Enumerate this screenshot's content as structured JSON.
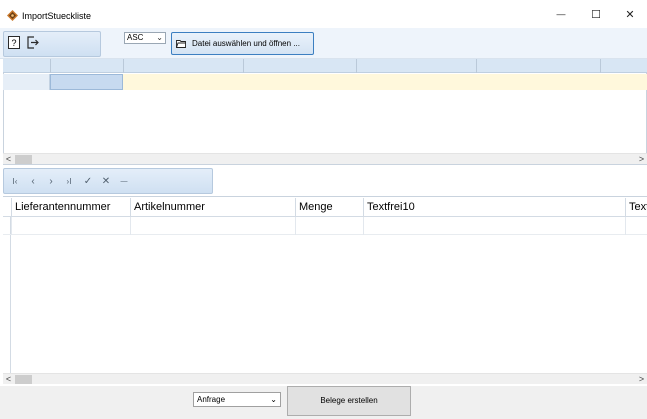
{
  "window": {
    "title": "ImportStueckliste",
    "minimize_glyph": "—",
    "maximize_glyph": "☐",
    "close_glyph": "✕"
  },
  "toolbar": {
    "help_icon": "help-icon",
    "exit_icon": "exit-icon",
    "sort_select_value": "ASC",
    "open_file_label": "Datei auswählen und öffnen ..."
  },
  "navigator": {
    "first": "I‹",
    "prev": "‹",
    "next": "›",
    "last": "›I",
    "confirm": "✓",
    "cancel": "✕",
    "delete": "—"
  },
  "scroll": {
    "left": "<",
    "right": ">"
  },
  "lower_grid": {
    "columns": [
      "Lieferantennummer",
      "Artikelnummer",
      "Menge",
      "Textfrei10",
      "Textfrei"
    ]
  },
  "footer": {
    "doc_type_value": "Anfrage",
    "create_button_label": "Belege erstellen"
  },
  "colors": {
    "accent_border": "#3c7fc1",
    "header_blue": "#d8e6f4",
    "selected_row": "#fff8dc",
    "selected_cell": "#c7daf0"
  }
}
